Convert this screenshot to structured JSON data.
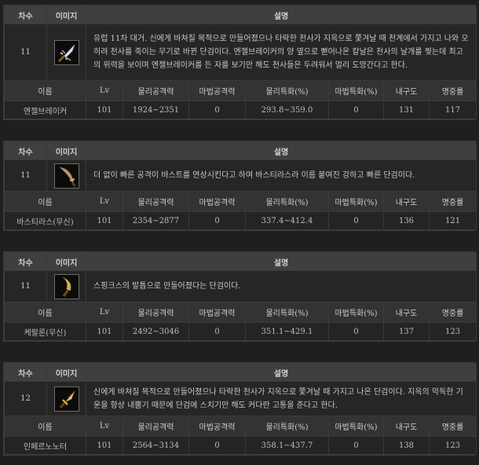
{
  "header": {
    "tier": "차수",
    "image": "이미지",
    "description": "설명"
  },
  "stats_header": {
    "name": "이름",
    "lv": "Lv",
    "physical_attack": "물리공격력",
    "magic_attack": "마법공격력",
    "physical_crit": "물리특화(%)",
    "magic_crit": "마법특화(%)",
    "durability": "내구도",
    "accuracy": "명중률"
  },
  "items": [
    {
      "tier": "11",
      "icon": "angel-dagger-icon",
      "description": "유럽 11차 대거. 신에게 바쳐질 목적으로 만들어졌으나 타락한 천사가 지옥으로 쫓겨날 때 천계에서 가지고 나와 오히려 천사를 죽이는 무기로 바뀐 단검이다. 엔젤브레이커의 양 옆으로 뻗어나온 칼날은 천사의 날개를 찢는데 최고의 위력을 보이며 엔젤브레이커를 든 자를 보기만 해도 천사들은 두려워서 멀리 도망간다고 한다.",
      "name": "엔젤브레이커",
      "lv": "101",
      "physical_attack": "1924~2351",
      "magic_attack": "0",
      "physical_crit": "293.8~359.0",
      "magic_crit": "0",
      "durability": "131",
      "accuracy": "117"
    },
    {
      "tier": "11",
      "icon": "bastirath-dagger-icon",
      "description": "더 없이 빠른 공격이 바스트를 연상시킨다고 하여 바스티라스라 이름 붙여진 강하고 빠른 단검이다.",
      "name": "바스티라스(무신)",
      "lv": "101",
      "physical_attack": "2354~2877",
      "magic_attack": "0",
      "physical_crit": "337.4~412.4",
      "magic_crit": "0",
      "durability": "136",
      "accuracy": "121"
    },
    {
      "tier": "11",
      "icon": "sphinx-claw-dagger-icon",
      "description": "스핑크스의 발톱으로 만들어졌다는 단검이다.",
      "name": "케랄론(무신)",
      "lv": "101",
      "physical_attack": "2492~3046",
      "magic_attack": "0",
      "physical_crit": "351.1~429.1",
      "magic_crit": "0",
      "durability": "137",
      "accuracy": "123"
    },
    {
      "tier": "12",
      "icon": "infernonoter-dagger-icon",
      "description": "신에게 바쳐질 목적으로 만들어졌으나 타락한 천사가 지옥으로 쫓겨날 때 가지고 나온 단검이다. 지옥의 악독한 기운을 항상 내뿜기 때문에 단검에 스치기만 해도 커다란 고통을 준다고 한다.",
      "name": "인페르노노터",
      "lv": "101",
      "physical_attack": "2564~3134",
      "magic_attack": "0",
      "physical_crit": "358.1~437.7",
      "magic_crit": "0",
      "durability": "138",
      "accuracy": "123"
    }
  ]
}
